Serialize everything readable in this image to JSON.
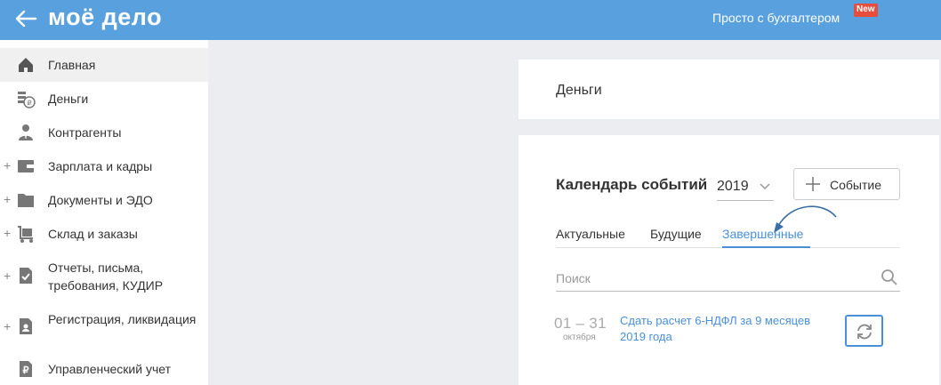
{
  "header": {
    "logo": "моё дело",
    "promo_link": "Просто с бухгалтером",
    "new_badge": "New"
  },
  "sidebar": {
    "items": [
      {
        "label": "Главная",
        "icon": "home-icon",
        "expandable": false,
        "active": true
      },
      {
        "label": "Деньги",
        "icon": "money-icon",
        "expandable": false
      },
      {
        "label": "Контрагенты",
        "icon": "person-icon",
        "expandable": false
      },
      {
        "label": "Зарплата и кадры",
        "icon": "wallet-icon",
        "expandable": true
      },
      {
        "label": "Документы и ЭДО",
        "icon": "folder-icon",
        "expandable": true
      },
      {
        "label": "Склад и заказы",
        "icon": "cart-icon",
        "expandable": true
      },
      {
        "label": "Отчеты, письма, требования, КУДИР",
        "icon": "report-icon",
        "expandable": true
      },
      {
        "label": "Регистрация, ликвидация",
        "icon": "registration-icon",
        "expandable": true
      },
      {
        "label": "Управленческий учет",
        "icon": "ruble-icon",
        "expandable": false
      }
    ]
  },
  "money_card": {
    "title": "Деньги"
  },
  "calendar": {
    "title": "Календарь событий",
    "year": "2019",
    "add_event_label": "Событие",
    "tabs": [
      {
        "label": "Актуальные",
        "active": false
      },
      {
        "label": "Будущие",
        "active": false
      },
      {
        "label": "Завершенные",
        "active": true
      }
    ],
    "search_placeholder": "Поиск",
    "events": [
      {
        "date_range": "01 – 31",
        "month": "октября",
        "title": "Сдать расчет 6-НДФЛ за 9 месяцев 2019 года"
      }
    ]
  },
  "colors": {
    "header_bg": "#59a0de",
    "accent": "#4a90d9",
    "badge": "#e74c3c"
  }
}
